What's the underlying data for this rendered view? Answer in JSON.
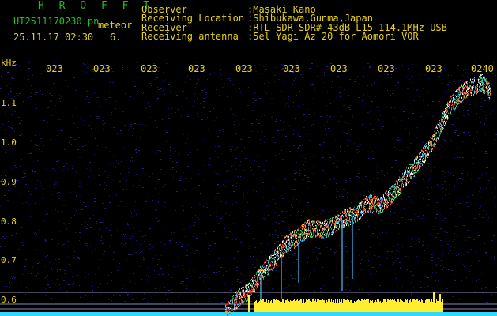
{
  "header": {
    "app_title": "H R O F F T",
    "filename": "UT2511170230.pn",
    "type_label": "meteor",
    "datetime": "25.11.17 02:30",
    "count": "6.",
    "info_labels": [
      "Observer",
      "Receiving Location",
      "Receiver",
      "Receiving antenna"
    ],
    "info_values": [
      ":Masaki Kano",
      ":Shibukawa,Gunma,Japan",
      ":RTL-SDR SDR# 43dB L15 114.1MHz USB",
      ":5el Yagi Az 20 for Aomori VOR"
    ]
  },
  "time_axis": [
    "023",
    "023",
    "023",
    "023",
    "023",
    "023",
    "023",
    "023",
    "023",
    "0240"
  ],
  "freq_axis": {
    "unit": "kHz",
    "labels": [
      "1.1",
      "1.0",
      "0.9",
      "0.8",
      "0.7",
      "0.6"
    ]
  },
  "colors": {
    "background": "#000000",
    "noise": "#1a1a6e",
    "signal_hot": "#ff3030",
    "signal_mid": "#30e060",
    "signal_cool": "#40c0ff",
    "carrier": "#ffee30",
    "baseline": "#30d8ff",
    "label_yellow": "#e8d21a",
    "label_green": "#1ec21e"
  }
}
